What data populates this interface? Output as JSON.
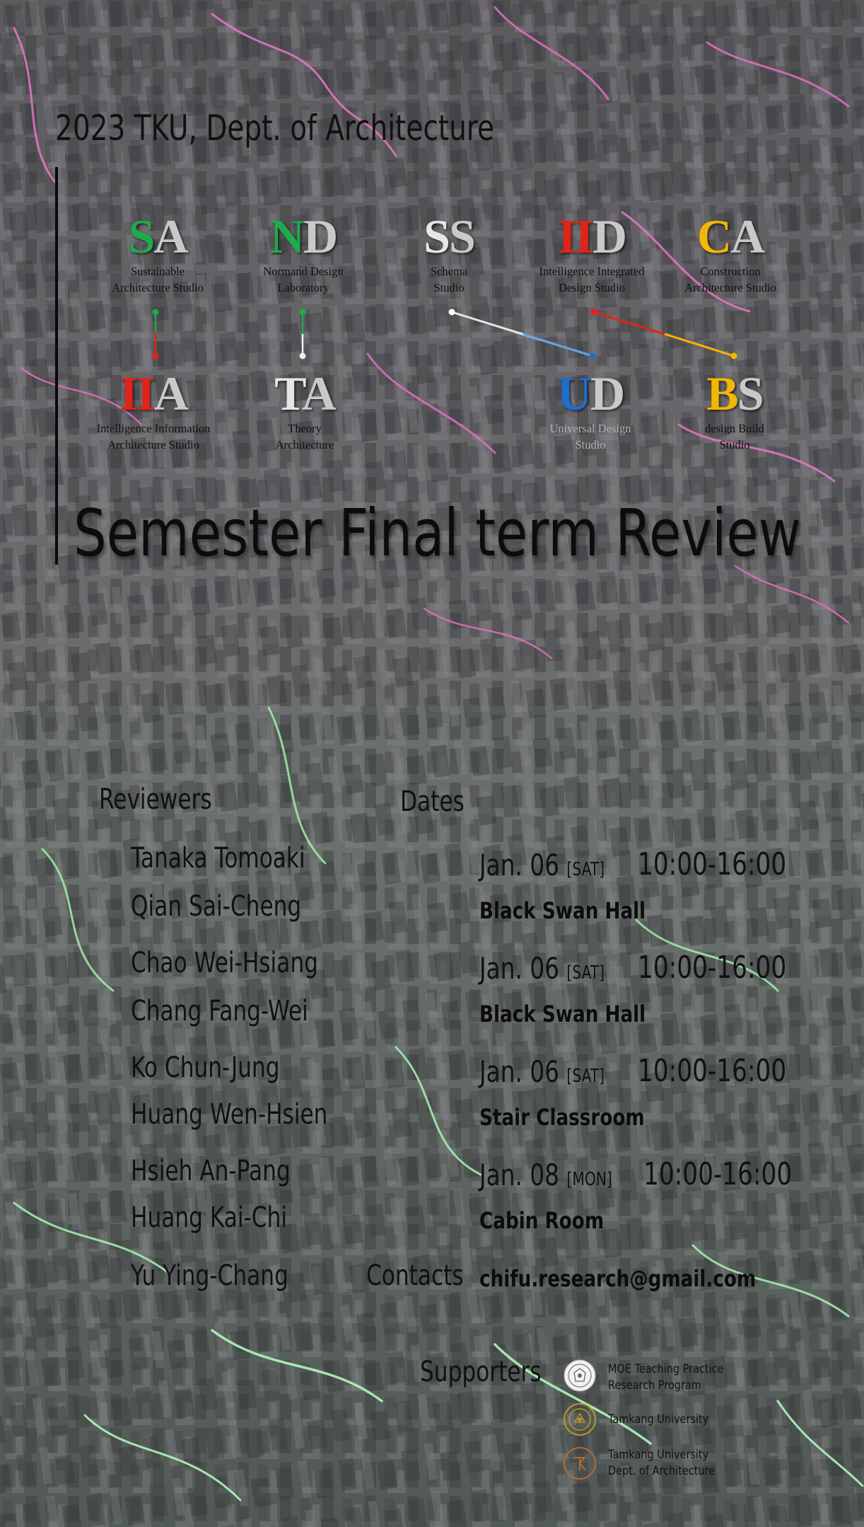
{
  "header": {
    "title": "2023  TKU, Dept. of Architecture"
  },
  "studios": [
    {
      "accent": "S",
      "rest": "A",
      "accent_color": "#1faa4b",
      "name": "Sustainable\nArchitecture Studio"
    },
    {
      "accent": "N",
      "rest": "D",
      "accent_color": "#1faa4b",
      "name": "Normand Design\nLaboratory"
    },
    {
      "accent": "S",
      "rest": "S",
      "accent_color": "#e6e6e6",
      "name": "Schema\nStudio"
    },
    {
      "accent": "II",
      "rest": "D",
      "accent_color": "#e2231a",
      "name": "Intelligence Integrated\nDesign Studio"
    },
    {
      "accent": "C",
      "rest": "A",
      "accent_color": "#f2b705",
      "name": "Construction\nArchitecture Studio"
    },
    {
      "accent": "II",
      "rest": "A",
      "accent_color": "#e2231a",
      "name": "Intelligence Information\nArchitecture Studio"
    },
    {
      "accent": "T",
      "rest": "A",
      "accent_color": "#e6e6e6",
      "name": "Theory\nArchitecture"
    },
    {
      "accent": "U",
      "rest": "D",
      "accent_color": "#1a6fd1",
      "name": "Universal Design\nStudio"
    },
    {
      "accent": "B",
      "rest": "S",
      "accent_color": "#f2b705",
      "name": "design Build\nStudio"
    }
  ],
  "main_title": "Semester Final term Review",
  "reviewers": {
    "heading": "Reviewers",
    "names": [
      "Tanaka Tomoaki",
      "Qian Sai-Cheng",
      "Chao Wei-Hsiang",
      "Chang Fang-Wei",
      "Ko Chun-Jung",
      "Huang Wen-Hsien",
      "Hsieh An-Pang",
      "Huang Kai-Chi",
      "Yu Ying-Chang"
    ]
  },
  "dates": {
    "heading": "Dates",
    "sessions": [
      {
        "date": "Jan. 06",
        "day": "[SAT]",
        "time": "10:00-16:00",
        "venue": "Black Swan Hall"
      },
      {
        "date": "Jan. 06",
        "day": "[SAT]",
        "time": "10:00-16:00",
        "venue": "Black Swan Hall"
      },
      {
        "date": "Jan. 06",
        "day": "[SAT]",
        "time": "10:00-16:00",
        "venue": "Stair Classroom"
      },
      {
        "date": "Jan. 08",
        "day": "[MON]",
        "time": "10:00-16:00",
        "venue": "Cabin Room"
      }
    ]
  },
  "contacts": {
    "heading": "Contacts",
    "email": "chifu.research@gmail.com"
  },
  "supporters": {
    "heading": "Supporters",
    "items": [
      {
        "name": "MOE Teaching Practice\nResearch Program",
        "icon": "moe-seal-icon"
      },
      {
        "name": "Tamkang University",
        "icon": "tku-seal-icon"
      },
      {
        "name": "Tamkang University\nDept. of Architecture",
        "icon": "tku-arch-logo-icon"
      }
    ]
  },
  "colors": {
    "link_green": "#1faa4b",
    "link_red": "#e2231a",
    "link_blue": "#1a6fd1",
    "link_yellow": "#f2b705"
  }
}
